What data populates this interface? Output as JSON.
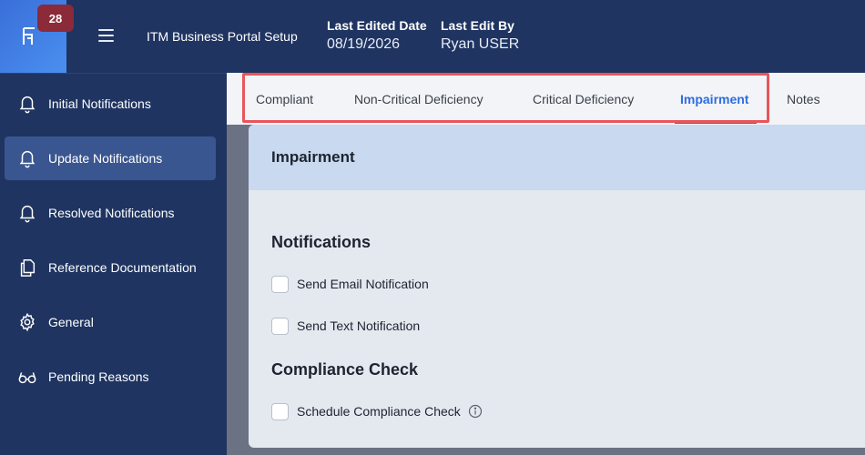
{
  "header": {
    "notification_count": "28",
    "app_title": "ITM Business Portal Setup",
    "last_edited_date_label": "Last Edited Date",
    "last_edited_date_value": "08/19/2026",
    "last_edit_by_label": "Last Edit By",
    "last_edit_by_value": "Ryan USER"
  },
  "sidebar": {
    "items": [
      {
        "label": "Initial Notifications",
        "icon": "bell-icon",
        "active": false
      },
      {
        "label": "Update Notifications",
        "icon": "bell-icon",
        "active": true
      },
      {
        "label": "Resolved Notifications",
        "icon": "bell-icon",
        "active": false
      },
      {
        "label": "Reference Documentation",
        "icon": "document-icon",
        "active": false
      },
      {
        "label": "General",
        "icon": "gear-icon",
        "active": false
      },
      {
        "label": "Pending Reasons",
        "icon": "glasses-icon",
        "active": false
      }
    ]
  },
  "tabs": [
    {
      "label": "Compliant",
      "active": false
    },
    {
      "label": "Non-Critical Deficiency",
      "active": false
    },
    {
      "label": "Critical Deficiency",
      "active": false
    },
    {
      "label": "Impairment",
      "active": true
    },
    {
      "label": "Notes",
      "active": false
    }
  ],
  "panel": {
    "title": "Impairment",
    "notifications_heading": "Notifications",
    "send_email_label": "Send Email Notification",
    "send_text_label": "Send Text Notification",
    "compliance_heading": "Compliance Check",
    "schedule_label": "Schedule Compliance Check"
  },
  "colors": {
    "header_bg": "#1f3461",
    "accent": "#2d6de0",
    "badge": "#8b2a38",
    "highlight": "#e8555a"
  }
}
